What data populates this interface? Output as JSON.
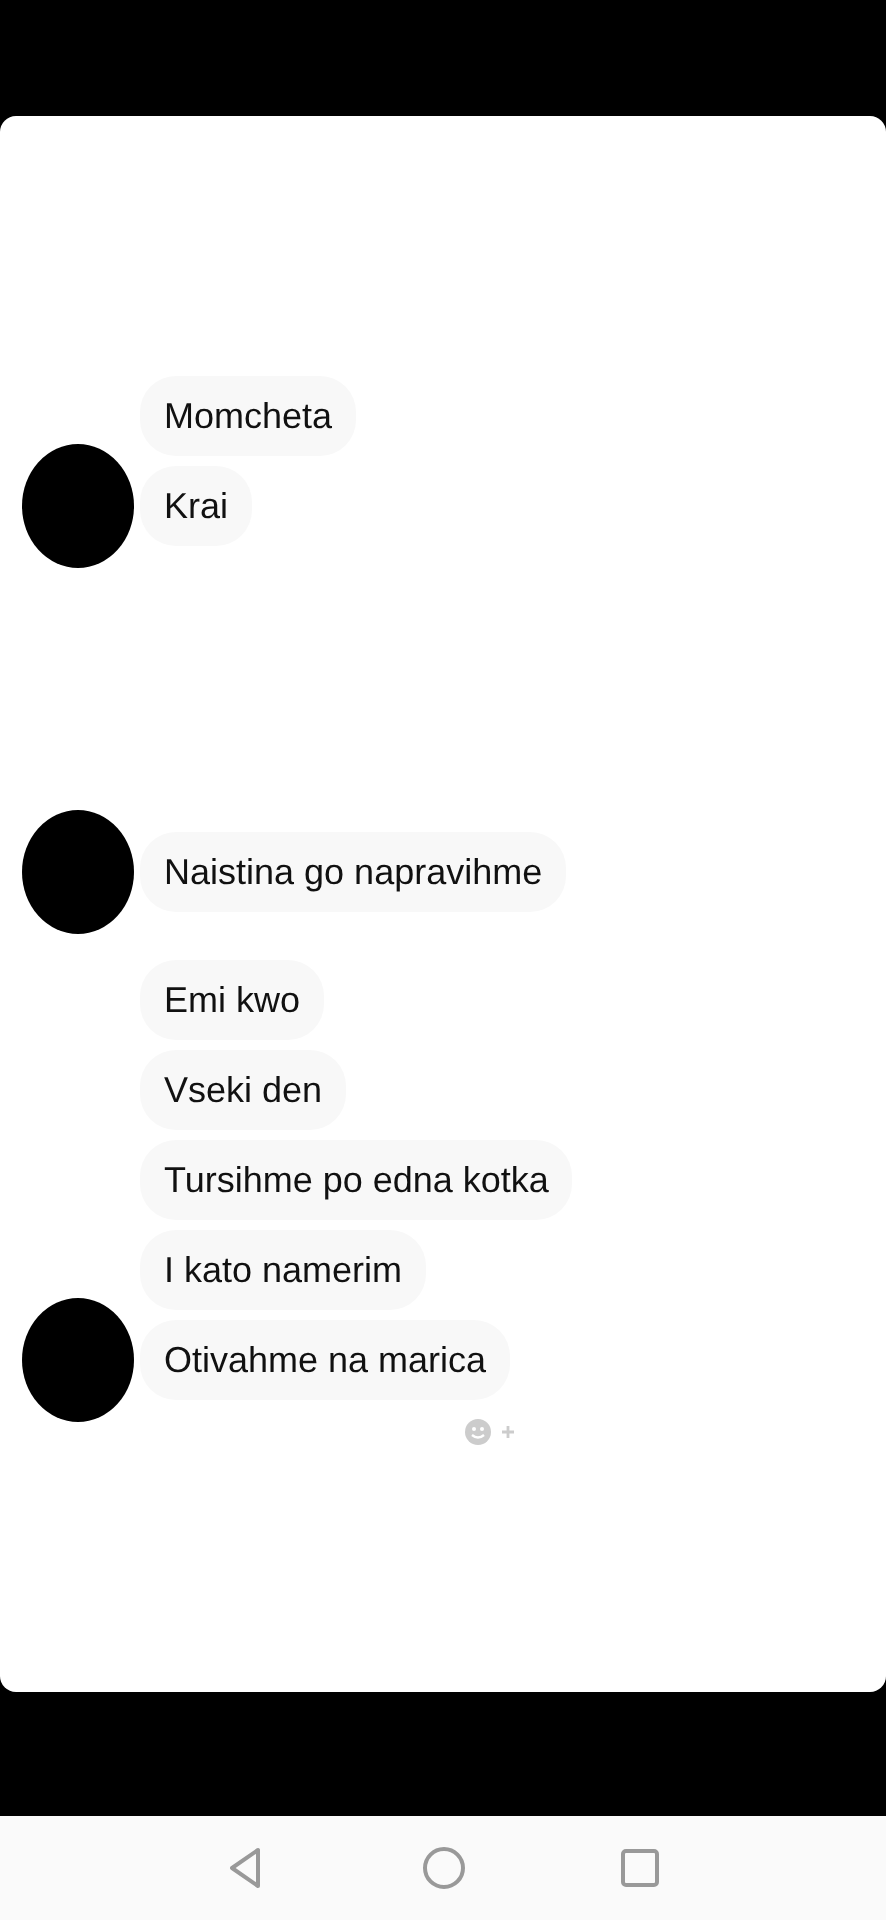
{
  "groups": [
    {
      "messages": [
        {
          "text": "Momcheta",
          "avatar": false
        },
        {
          "text": "Krai",
          "avatar": true
        }
      ],
      "reaction": false
    },
    {
      "messages": [
        {
          "text": "Naistina go napravihme",
          "avatar": true
        }
      ],
      "reaction": false
    },
    {
      "messages": [
        {
          "text": "Emi kwo",
          "avatar": false
        },
        {
          "text": "Vseki den",
          "avatar": false
        },
        {
          "text": "Tursihme po edna kotka",
          "avatar": false
        },
        {
          "text": "I kato namerim",
          "avatar": false
        },
        {
          "text": "Otivahme na marica",
          "avatar": true
        }
      ],
      "reaction": true
    }
  ],
  "nav_bar": {
    "buttons": [
      {
        "kind": "back"
      },
      {
        "kind": "home"
      },
      {
        "kind": "recents"
      }
    ]
  }
}
